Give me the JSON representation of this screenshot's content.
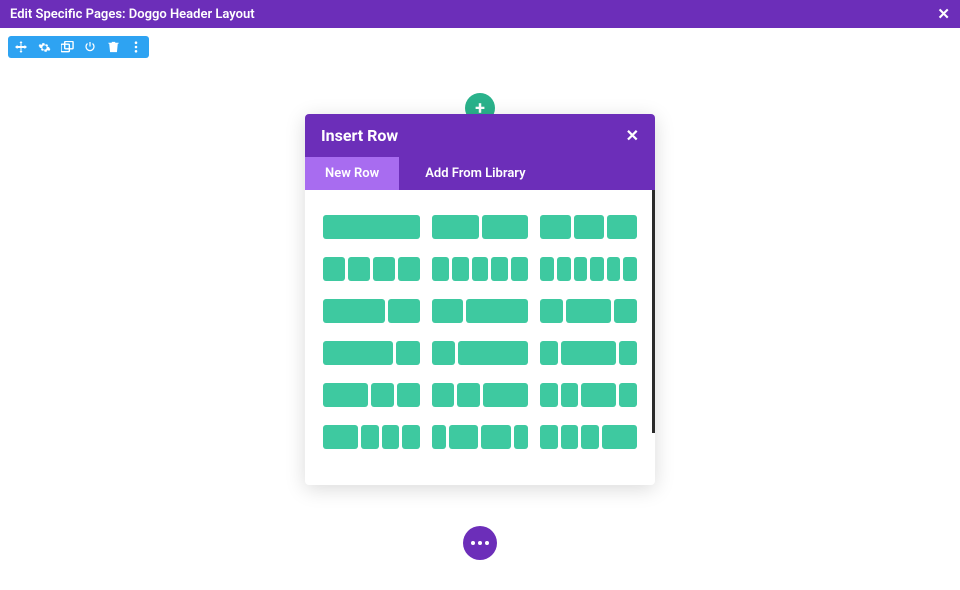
{
  "topbar": {
    "title": "Edit Specific Pages: Doggo Header Layout",
    "close": "✕"
  },
  "toolbar": {
    "icons": [
      "move",
      "gear",
      "duplicate",
      "power",
      "trash",
      "more"
    ]
  },
  "add_button": {
    "glyph": "+"
  },
  "modal": {
    "title": "Insert Row",
    "close": "✕",
    "tabs": [
      {
        "id": "new",
        "label": "New Row",
        "active": true
      },
      {
        "id": "library",
        "label": "Add From Library",
        "active": false
      }
    ],
    "layouts": [
      [
        1
      ],
      [
        1,
        1
      ],
      [
        1,
        1,
        1
      ],
      [
        1,
        1,
        1,
        1
      ],
      [
        1,
        1,
        1,
        1,
        1
      ],
      [
        1,
        1,
        1,
        1,
        1,
        1
      ],
      [
        2,
        1
      ],
      [
        1,
        2
      ],
      [
        1,
        2,
        1
      ],
      [
        3,
        1
      ],
      [
        1,
        3
      ],
      [
        1,
        3,
        1
      ],
      [
        2,
        1,
        1
      ],
      [
        1,
        1,
        2
      ],
      [
        1,
        1,
        2,
        1
      ],
      [
        2,
        1,
        1,
        1
      ],
      [
        1,
        2,
        2,
        1
      ],
      [
        1,
        1,
        1,
        2
      ]
    ]
  },
  "colors": {
    "accent_purple": "#6c2eb9",
    "accent_teal": "#3ec9a0",
    "toolbar_blue": "#2ea3f2"
  }
}
